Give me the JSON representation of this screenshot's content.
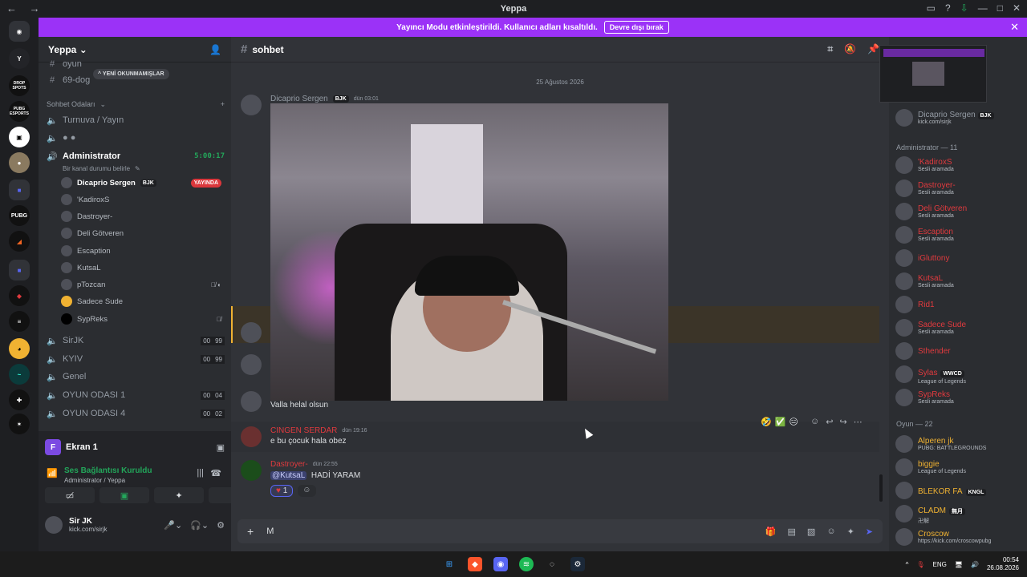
{
  "window": {
    "title": "Yeppa"
  },
  "banner": {
    "text": "Yayıncı Modu etkinleştirildi. Kullanıcı adları kısaltıldı.",
    "button": "Devre dışı bırak"
  },
  "guilds": [
    "DROP SPOTS",
    "PUBG ESPORTS",
    "PUBG"
  ],
  "server": {
    "name": "Yeppa"
  },
  "channels": {
    "partial_top": "oyun",
    "text_channel": "69-dog",
    "new_unread": "YENİ OKUNMAMIŞLAR",
    "category": "Sohbet Odaları",
    "voice": [
      {
        "name": "Turnuva / Yayın"
      },
      {
        "name": "Administrator",
        "timer": "5:00:17",
        "status": "Bir kanal durumu belirle"
      },
      {
        "name": "SirJK",
        "c1": "00",
        "c2": "99"
      },
      {
        "name": "KYIV",
        "c1": "00",
        "c2": "99"
      },
      {
        "name": "Genel"
      },
      {
        "name": "OYUN ODASI 1",
        "c1": "00",
        "c2": "04"
      },
      {
        "name": "OYUN ODASI 4",
        "c1": "00",
        "c2": "02"
      }
    ],
    "voice_users": [
      {
        "name": "Dicaprio Sergen",
        "tag": "BJK",
        "live": "YAYINDA"
      },
      {
        "name": "'KadiroxS"
      },
      {
        "name": "Dastroyer-"
      },
      {
        "name": "Deli Götveren"
      },
      {
        "name": "Escaption"
      },
      {
        "name": "KutsaL"
      },
      {
        "name": "pTozcan"
      },
      {
        "name": "Sadece Sude"
      },
      {
        "name": "SypReks"
      }
    ]
  },
  "panel": {
    "ekran": "Ekran 1",
    "ekran_letter": "F",
    "voice_status": "Ses Bağlantısı Kuruldu",
    "voice_where": "Administrator / Yeppa",
    "user_name": "Sir JK",
    "user_status": "kick.com/sirjk"
  },
  "chat": {
    "channel": "sohbet",
    "date": "25 Ağustos 2026",
    "first_author": "Dicaprio Sergen",
    "first_tag": "BJK",
    "first_time": "dün 03:01",
    "msg_valla": "Valla helal olsun",
    "m2_author": "CINGEN SERDAR",
    "m2_time": "dün 19:16",
    "m2_text": "e bu çocuk hala obez",
    "m3_author": "Dastroyer-",
    "m3_time": "dün 22:55",
    "m3_mention": "@KutsaL",
    "m3_text": "HADİ YARAM",
    "reaction_count": "1",
    "composer_text": "M"
  },
  "members": {
    "top": {
      "name": "Dicaprio Sergen",
      "tag": "BJK",
      "status": "kick.com/sirjk"
    },
    "admin_header": "Administrator — 11",
    "admin": [
      {
        "name": "'KadiroxS",
        "status": "Sesli aramada",
        "color": "#e03a3e"
      },
      {
        "name": "Dastroyer-",
        "status": "Sesli aramada",
        "color": "#e03a3e"
      },
      {
        "name": "Deli Götveren",
        "status": "Sesli aramada",
        "color": "#e03a3e"
      },
      {
        "name": "Escaption",
        "status": "Sesli aramada",
        "color": "#e03a3e"
      },
      {
        "name": "iGluttony",
        "status": "",
        "color": "#e03a3e"
      },
      {
        "name": "KutsaL",
        "status": "Sesli aramada",
        "color": "#e03a3e"
      },
      {
        "name": "Rid1",
        "status": "",
        "color": "#e03a3e"
      },
      {
        "name": "Sadece Sude",
        "status": "Sesli aramada",
        "color": "#e03a3e"
      },
      {
        "name": "Sthender",
        "status": "",
        "color": "#e03a3e"
      },
      {
        "name": "Sylas",
        "status": "League of Legends",
        "color": "#e03a3e",
        "tag": "WWCD"
      },
      {
        "name": "SypReks",
        "status": "Sesli aramada",
        "color": "#e03a3e"
      }
    ],
    "oyun_header": "Oyun — 22",
    "oyun": [
      {
        "name": "Alperen jk",
        "status": "PUBG: BATTLEGROUNDS",
        "color": "#f0b232"
      },
      {
        "name": "biggie",
        "status": "League of Legends",
        "color": "#f0b232"
      },
      {
        "name": "BLEKOR FA",
        "status": "",
        "color": "#f0b232",
        "tag": "KNGL"
      },
      {
        "name": "CLADM",
        "status": "卍解",
        "color": "#f0b232",
        "tag": "無月"
      },
      {
        "name": "Croscow",
        "status": "https://kick.com/croscowpubg",
        "color": "#f0b232"
      }
    ]
  },
  "taskbar": {
    "lang": "ENG",
    "time": "00:54",
    "date": "26.08.2026"
  }
}
